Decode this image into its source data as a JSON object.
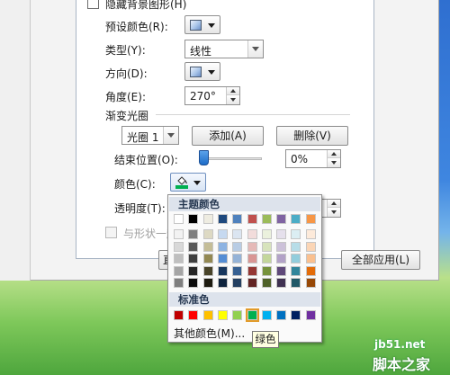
{
  "format_panel": {
    "hide_bg_label": "隐藏背景图形(H)",
    "preset_color_label": "预设颜色(R):",
    "type_label": "类型(Y):",
    "type_value": "线性",
    "direction_label": "方向(D):",
    "angle_label": "角度(E):",
    "angle_value": "270°",
    "stops_section_label": "渐变光圈",
    "stop_select_value": "光圈 1",
    "add_button": "添加(A)",
    "delete_button": "删除(V)",
    "end_pos_label": "结束位置(O):",
    "end_pos_value": "0%",
    "end_pos_slider_fraction": 0.0,
    "color_label": "颜色(C):",
    "transparency_label": "透明度(T):",
    "align_shape_label": "与形状一起",
    "apply_all_button": "全部应用(L)",
    "partial_button_text": "直"
  },
  "palette": {
    "theme_header": "主题颜色",
    "standard_header": "标准色",
    "more_colors": "其他颜色(M)...",
    "tooltip": "绿色",
    "theme_colors": [
      "#ffffff",
      "#000000",
      "#eeece1",
      "#1f497d",
      "#4f81bd",
      "#c0504d",
      "#9bbb59",
      "#8064a2",
      "#4bacc6",
      "#f79646"
    ],
    "theme_shades": [
      [
        "#f2f2f2",
        "#7f7f7f",
        "#ddd9c3",
        "#c6d9f0",
        "#dbe5f1",
        "#f2dcdb",
        "#ebf1dd",
        "#e5e0ec",
        "#dbeef3",
        "#fdeada"
      ],
      [
        "#d8d8d8",
        "#595959",
        "#c4bd97",
        "#8db3e2",
        "#b8cce4",
        "#e5b9b7",
        "#d7e3bc",
        "#ccc1d9",
        "#b7dde8",
        "#fbd5b5"
      ],
      [
        "#bfbfbf",
        "#3f3f3f",
        "#938953",
        "#548dd4",
        "#95b3d7",
        "#d99694",
        "#c3d69b",
        "#b2a2c7",
        "#92cddc",
        "#fac08f"
      ],
      [
        "#a5a5a5",
        "#262626",
        "#494429",
        "#17365d",
        "#366092",
        "#953734",
        "#76923c",
        "#5f497a",
        "#31859b",
        "#e36c09"
      ],
      [
        "#7f7f7f",
        "#0c0c0c",
        "#1d1b10",
        "#0f243e",
        "#244061",
        "#632423",
        "#4f6128",
        "#3f3151",
        "#205867",
        "#974806"
      ]
    ],
    "standard_colors": [
      "#c00000",
      "#ff0000",
      "#ffc000",
      "#ffff00",
      "#92d050",
      "#00b050",
      "#00b0f0",
      "#0070c0",
      "#002060",
      "#7030a0"
    ],
    "selected_standard_index": 5
  },
  "watermark": {
    "site": "jb51.net",
    "name": "脚本之家"
  }
}
